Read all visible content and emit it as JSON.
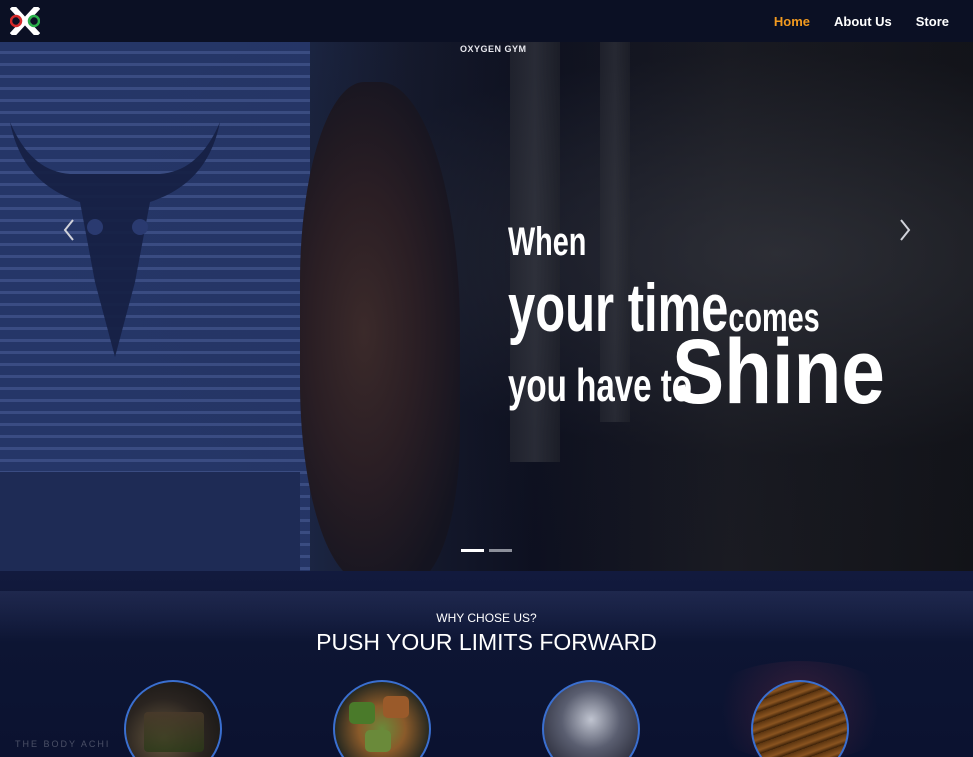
{
  "nav": {
    "logo_text": "OXG",
    "links": [
      {
        "label": "Home",
        "active": true
      },
      {
        "label": "About Us",
        "active": false
      },
      {
        "label": "Store",
        "active": false
      }
    ],
    "active_color": "#f29a1f"
  },
  "hero": {
    "brand": "OXYGEN GYM",
    "slogan": {
      "line1": "When",
      "line2_big": "your time",
      "line2_small": "comes",
      "line3_mid": "you have to",
      "line3_big": "Shine"
    },
    "prev_icon": "chevron-left-icon",
    "next_icon": "chevron-right-icon",
    "slides": 2,
    "active_slide": 1
  },
  "why": {
    "subtitle": "WHY CHOSE US?",
    "title": "PUSH YOUR LIMITS FORWARD",
    "watermark": "THE BODY ACHI",
    "cards": [
      {
        "name": "gym-equipment-image"
      },
      {
        "name": "healthy-food-image"
      },
      {
        "name": "trainer-image"
      },
      {
        "name": "sauna-image"
      }
    ],
    "accent": "#3a6fd0"
  }
}
